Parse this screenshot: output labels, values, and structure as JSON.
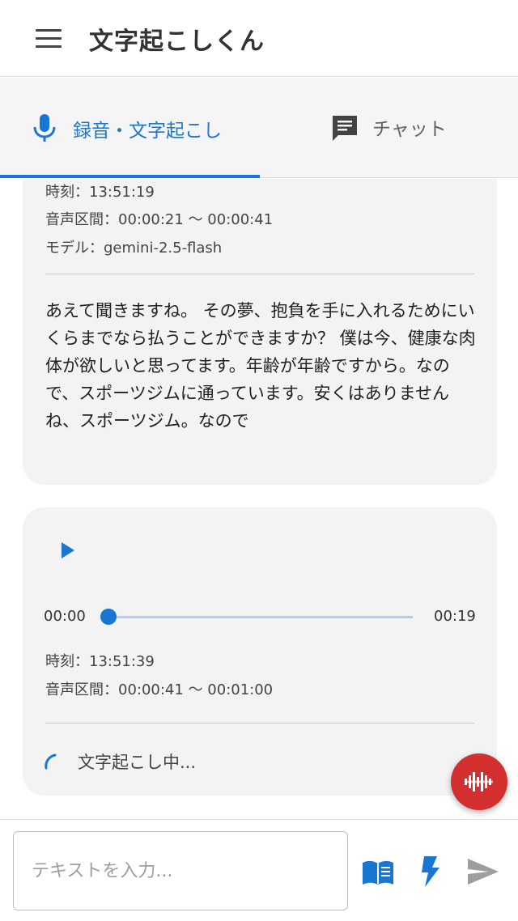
{
  "app": {
    "title": "文字起こしくん"
  },
  "tabs": [
    {
      "label": "録音・文字起こし",
      "icon": "mic-icon",
      "active": true
    },
    {
      "label": "チャット",
      "icon": "chat-icon",
      "active": false
    }
  ],
  "cards": [
    {
      "time_label": "時刻：13:51:19",
      "segment_label": "音声区間：00:00:21 〜 00:00:41",
      "model_label": "モデル：gemini-2.5-flash",
      "transcript": "あえて聞きますね。 その夢、抱負を手に入れるためにいくらまでなら払うことができますか？ 僕は今、健康な肉体が欲しいと思ってます。年齢が年齢ですから。なので、スポーツジムに通っています。安くはありませんね、スポーツジム。なので"
    },
    {
      "player": {
        "current_time": "00:00",
        "duration": "00:19",
        "progress": 0
      },
      "time_label": "時刻：13:51:39",
      "segment_label": "音声区間：00:00:41 〜 00:01:00",
      "status": "文字起こし中..."
    }
  ],
  "input": {
    "placeholder": "テキストを入力...",
    "value": ""
  },
  "colors": {
    "accent": "#1976d2",
    "fab": "#d32f2f",
    "card_bg": "#f3f3f3",
    "tab_bg": "#f5f5f5"
  },
  "icons": {
    "fab": "waveform-icon",
    "book": "book-icon",
    "bolt": "bolt-icon",
    "send": "send-icon"
  }
}
